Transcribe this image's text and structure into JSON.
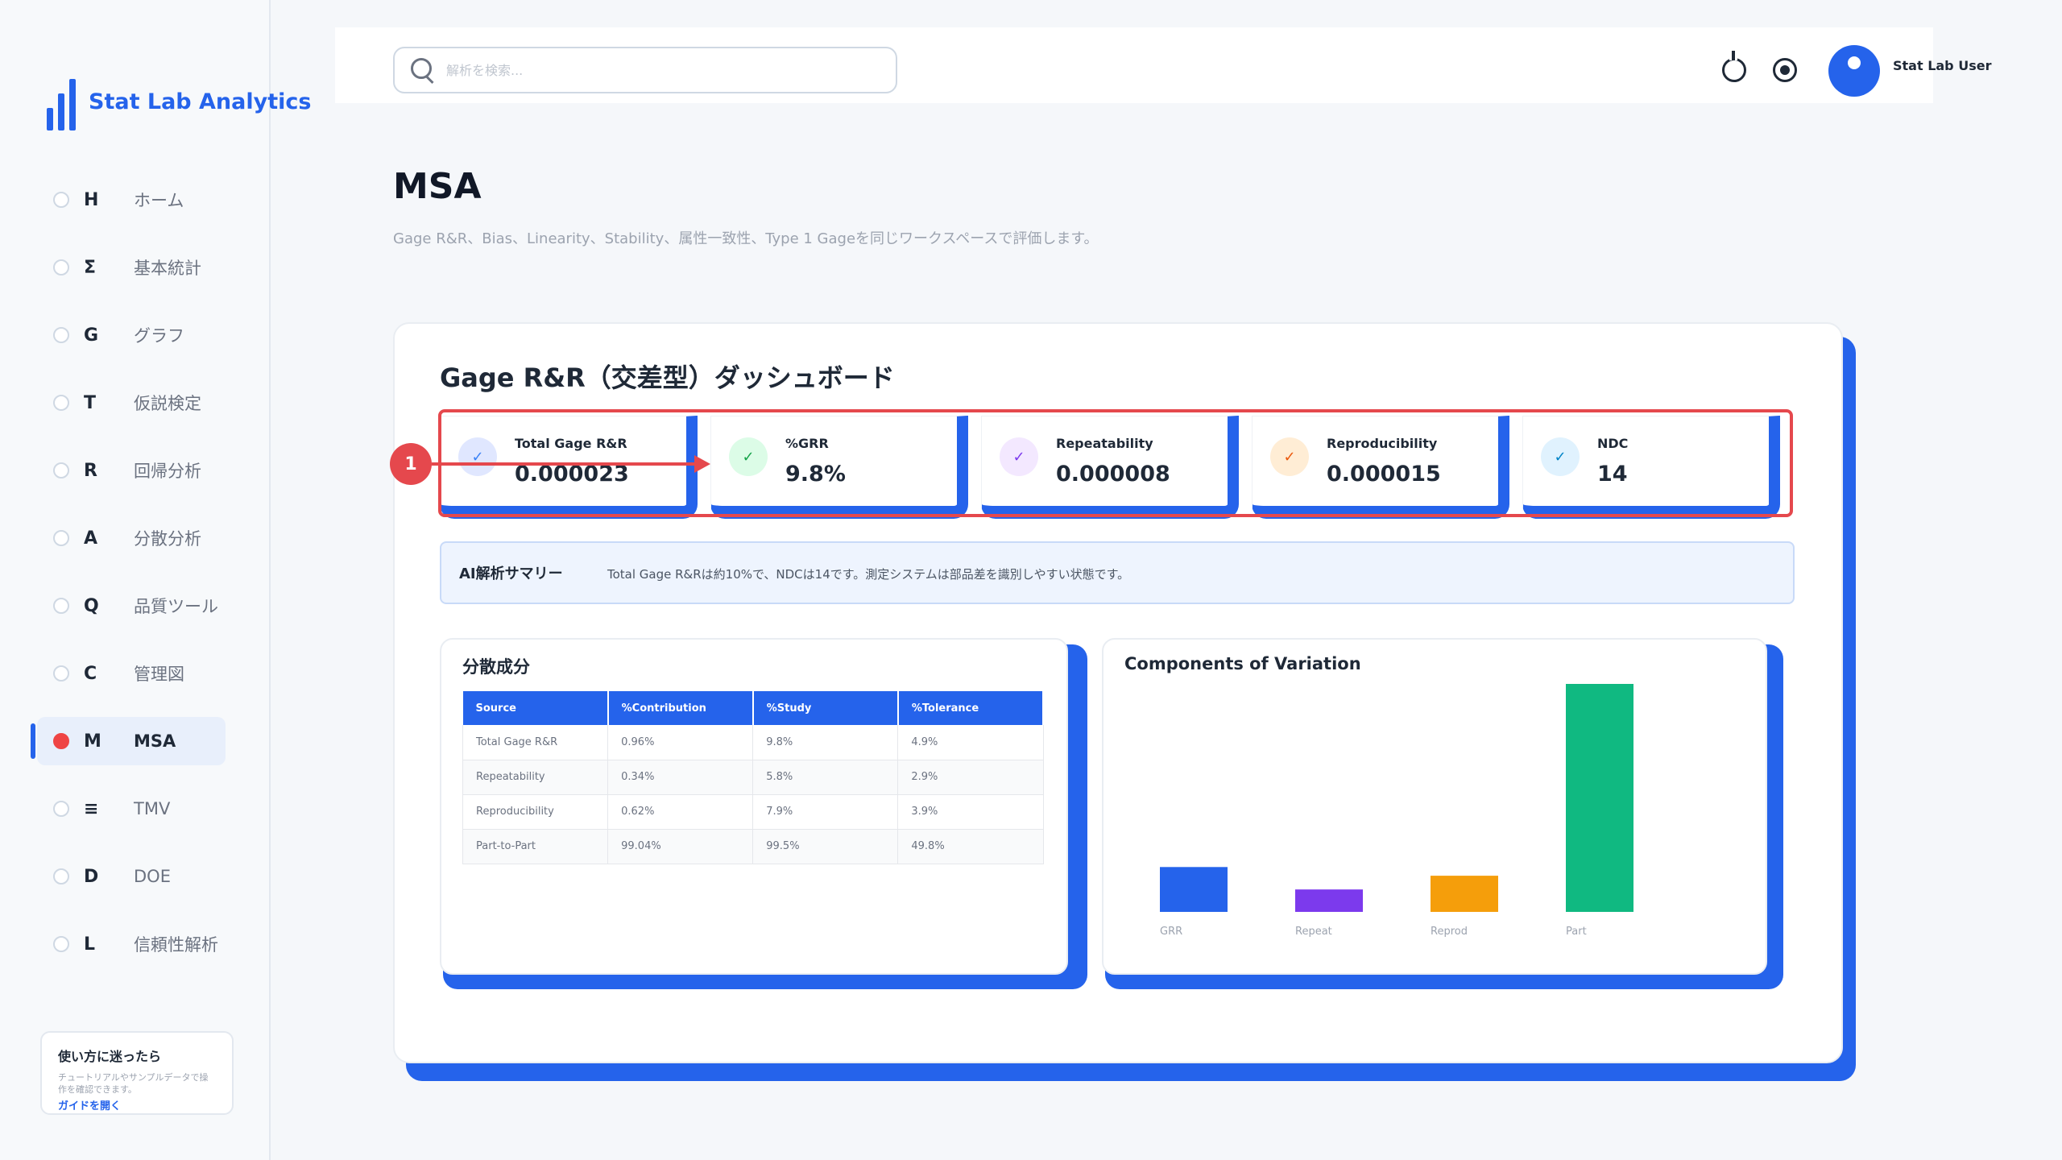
{
  "app": {
    "name": "Stat Lab Analytics"
  },
  "sidebar": {
    "items": [
      {
        "letter": "H",
        "label": "ホーム"
      },
      {
        "letter": "Σ",
        "label": "基本統計"
      },
      {
        "letter": "G",
        "label": "グラフ"
      },
      {
        "letter": "T",
        "label": "仮説検定"
      },
      {
        "letter": "R",
        "label": "回帰分析"
      },
      {
        "letter": "A",
        "label": "分散分析"
      },
      {
        "letter": "Q",
        "label": "品質ツール"
      },
      {
        "letter": "C",
        "label": "管理図"
      },
      {
        "letter": "M",
        "label": "MSA",
        "active": true
      },
      {
        "letter": "≡",
        "label": "TMV"
      },
      {
        "letter": "D",
        "label": "DOE"
      },
      {
        "letter": "L",
        "label": "信頼性解析"
      }
    ],
    "help": {
      "title": "使い方に迷ったら",
      "description": "チュートリアルやサンプルデータで操作を確認できます。",
      "link": "ガイドを開く"
    }
  },
  "topbar": {
    "search_placeholder": "解析を検索...",
    "user_name": "Stat Lab User"
  },
  "page": {
    "title": "MSA",
    "subtitle": "Gage R&R、Bias、Linearity、Stability、属性一致性、Type 1 Gageを同じワークスペースで評価します。"
  },
  "dashboard": {
    "title": "Gage R&R（交差型）ダッシュボード",
    "kpis": [
      {
        "label": "Total Gage R&R",
        "value": "0.000023",
        "icon": "check-icon",
        "color": "#e0e7ff"
      },
      {
        "label": "%GRR",
        "value": "9.8%",
        "icon": "check-icon",
        "color": "#dcfce7"
      },
      {
        "label": "Repeatability",
        "value": "0.000008",
        "icon": "check-icon",
        "color": "#f3e8ff"
      },
      {
        "label": "Reproducibility",
        "value": "0.000015",
        "icon": "check-icon",
        "color": "#ffedd5"
      },
      {
        "label": "NDC",
        "value": "14",
        "icon": "check-icon",
        "color": "#e0f2fe"
      }
    ],
    "ai_summary": {
      "label": "AI解析サマリー",
      "text": "Total Gage R&Rは約10%で、NDCは14です。測定システムは部品差を識別しやすい状態です。"
    },
    "variance": {
      "title": "分散成分",
      "headers": [
        "Source",
        "%Contribution",
        "%Study",
        "%Tolerance"
      ],
      "rows": [
        [
          "Total Gage R&R",
          "0.96%",
          "9.8%",
          "4.9%"
        ],
        [
          "Repeatability",
          "0.34%",
          "5.8%",
          "2.9%"
        ],
        [
          "Reproducibility",
          "0.62%",
          "7.9%",
          "3.9%"
        ],
        [
          "Part-to-Part",
          "99.04%",
          "99.5%",
          "49.8%"
        ]
      ]
    },
    "annotation": {
      "number": "1"
    }
  },
  "chart_data": {
    "type": "bar",
    "title": "Components of Variation",
    "categories": [
      "GRR",
      "Repeat",
      "Reprod",
      "Part"
    ],
    "values": [
      9.8,
      4.9,
      7.9,
      49.8
    ],
    "colors": [
      "#2563eb",
      "#7c3aed",
      "#f59e0b",
      "#10b981"
    ],
    "ylim": [
      0,
      49.8
    ],
    "grid": false
  }
}
